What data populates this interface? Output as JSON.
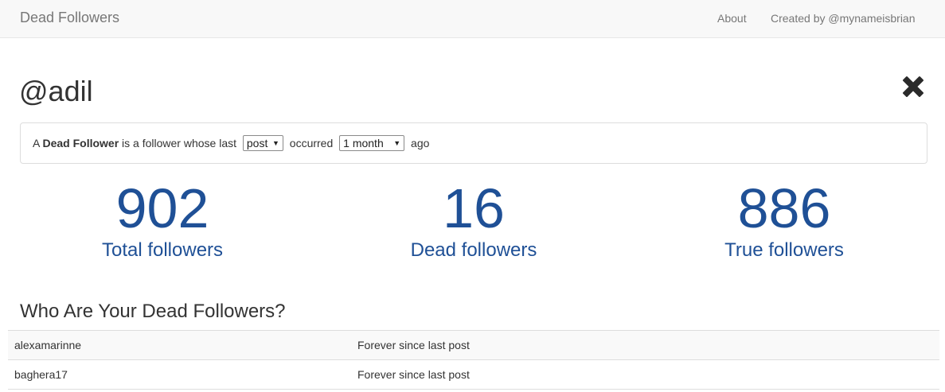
{
  "navbar": {
    "brand": "Dead Followers",
    "about": "About",
    "created_by": "Created by @mynameisbrian"
  },
  "header": {
    "username": "@adil",
    "close_icon": "close-x-icon"
  },
  "definition": {
    "prefix": "A ",
    "term": "Dead Follower",
    "middle": " is a follower whose last ",
    "activity_selected": "post",
    "occurred": " occurred ",
    "period_selected": "1 month",
    "suffix": " ago"
  },
  "stats": {
    "total": {
      "value": "902",
      "label": "Total followers"
    },
    "dead": {
      "value": "16",
      "label": "Dead followers"
    },
    "true": {
      "value": "886",
      "label": "True followers"
    }
  },
  "colors": {
    "accent": "#1f5096",
    "navbar_bg": "#f8f8f8"
  },
  "dead_list": {
    "title": "Who Are Your Dead Followers?",
    "rows": [
      {
        "username": "alexamarinne",
        "status": "Forever since last post"
      },
      {
        "username": "baghera17",
        "status": "Forever since last post"
      }
    ]
  }
}
